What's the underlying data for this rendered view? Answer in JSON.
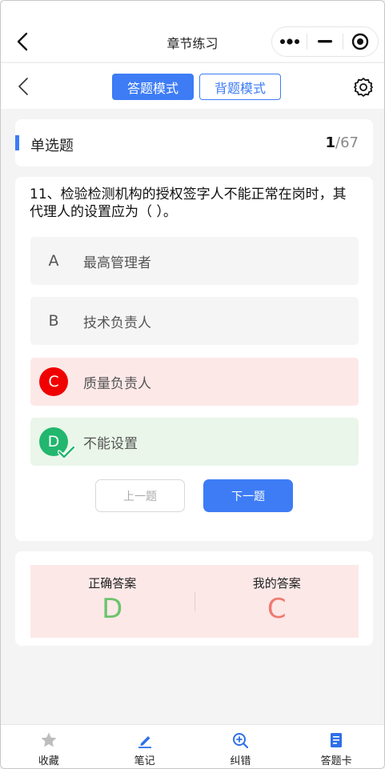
{
  "navbar": {
    "title": "章节练习",
    "back_icon": "chevron-left-icon",
    "capsule_icons": [
      "more-dots-icon",
      "minimize-icon",
      "close-circle-icon"
    ]
  },
  "mode_bar": {
    "tabs": [
      {
        "label": "答题模式",
        "active": true
      },
      {
        "label": "背题模式",
        "active": false
      }
    ],
    "settings_icon": "gear-icon"
  },
  "question_type": {
    "label": "单选题",
    "current": "1",
    "total": "/67"
  },
  "question": {
    "text": " 11、检验检测机构的授权签字人不能正常在岗时，其代理人的设置应为（ ）。",
    "options": [
      {
        "letter": "A",
        "text": "最高管理者",
        "state": "normal"
      },
      {
        "letter": "B",
        "text": "技术负责人",
        "state": "normal"
      },
      {
        "letter": "C",
        "text": "质量负责人",
        "state": "wrong"
      },
      {
        "letter": "D",
        "text": "不能设置",
        "state": "correct"
      }
    ]
  },
  "buttons": {
    "prev_label": "上一题",
    "next_label": "下一题"
  },
  "answer": {
    "correct_label": "正确答案",
    "correct_value": "D",
    "mine_label": "我的答案",
    "mine_value": "C"
  },
  "tabbar": {
    "items": [
      {
        "label": "收藏",
        "icon": "star-icon"
      },
      {
        "label": "笔记",
        "icon": "pencil-icon"
      },
      {
        "label": "纠错",
        "icon": "search-plus-icon"
      },
      {
        "label": "答题卡",
        "icon": "answer-sheet-icon"
      }
    ]
  },
  "colors": {
    "accent": "#3d7cf5",
    "wrong": "#f00000",
    "correct": "#22b66e",
    "answer_right": "#6cc46c",
    "answer_mine": "#ef7a6f"
  }
}
